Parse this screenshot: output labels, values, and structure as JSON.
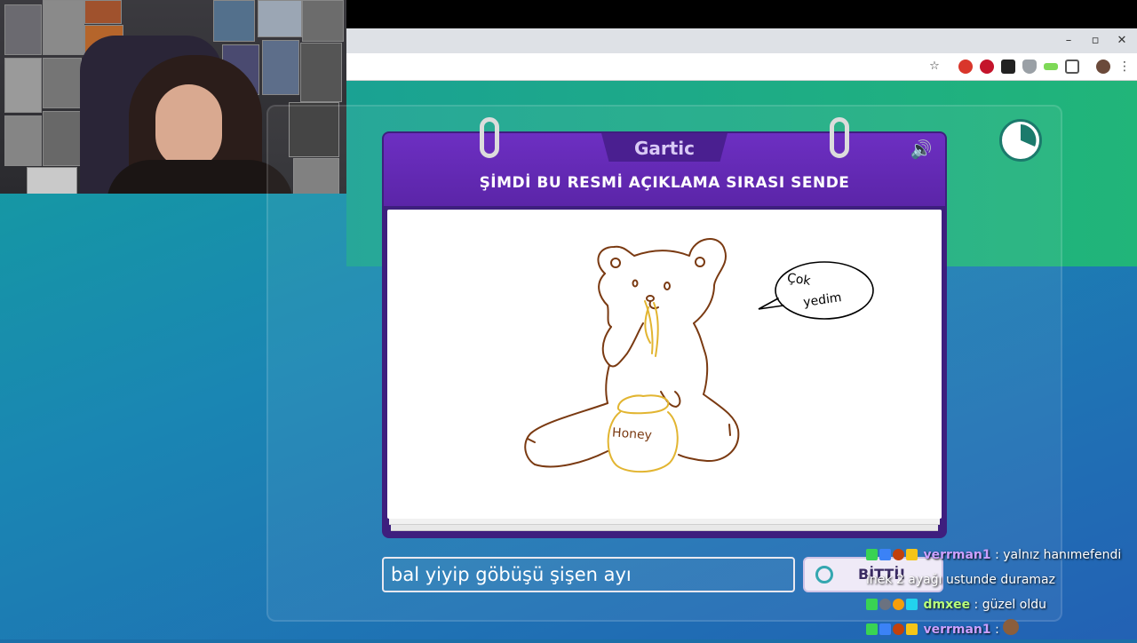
{
  "app": {
    "name": "Gartic"
  },
  "window": {
    "minimize": "–",
    "maximize": "▫",
    "close": "✕"
  },
  "toolbar_icons": [
    "star-icon",
    "extension-red-icon",
    "extension-red2-icon",
    "extension-dark-icon",
    "shield-icon",
    "battery-icon",
    "puzzle-icon",
    "avatar-icon",
    "menu-icon"
  ],
  "game": {
    "prompt": "ŞİMDİ BU RESMİ AÇIKLAMA SIRASI SENDE",
    "drawing_texts": {
      "speech_line1": "Çok",
      "speech_line2": "yedim",
      "jar_label": "Honey"
    },
    "answer_value": "bal yiyip göbüşü şişen ayı",
    "done_label": "BİTTİ!"
  },
  "chat": [
    {
      "user": "verrman1",
      "message": ": yalnız hanımefendi"
    },
    {
      "user": "",
      "message": "inek 2 ayağı ustunde duramaz"
    },
    {
      "user": "dmxee",
      "message": ": güzel oldu"
    },
    {
      "user": "verrman1",
      "message": ":"
    }
  ],
  "colors": {
    "accent_purple": "#5b25a8",
    "bear_stroke": "#7a3a12",
    "honey_stroke": "#e2b531"
  }
}
